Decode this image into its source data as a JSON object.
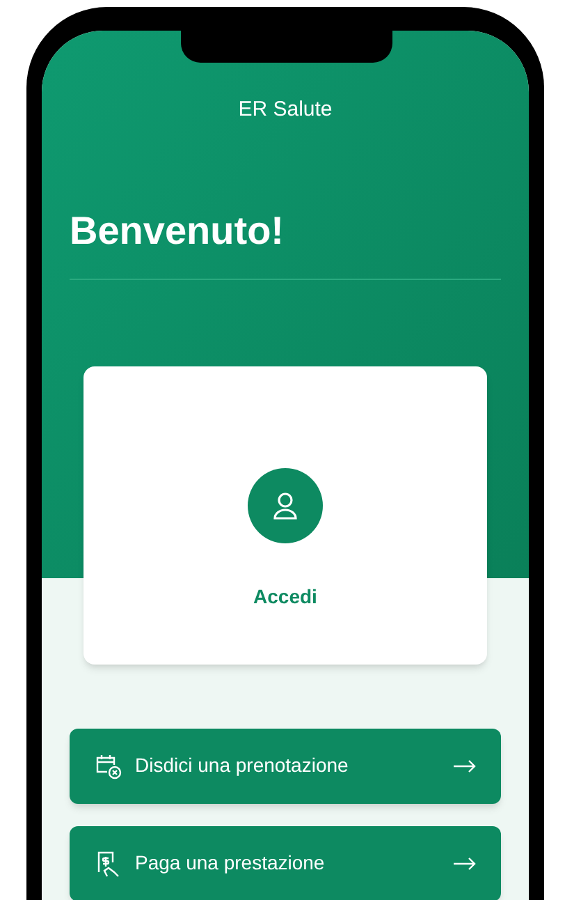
{
  "header": {
    "title": "ER Salute",
    "greeting": "Benvenuto!"
  },
  "login_card": {
    "label": "Accedi"
  },
  "actions": [
    {
      "kind": "cancel-booking",
      "label": "Disdici una prenotazione"
    },
    {
      "kind": "payment",
      "label": "Paga una prestazione"
    }
  ]
}
